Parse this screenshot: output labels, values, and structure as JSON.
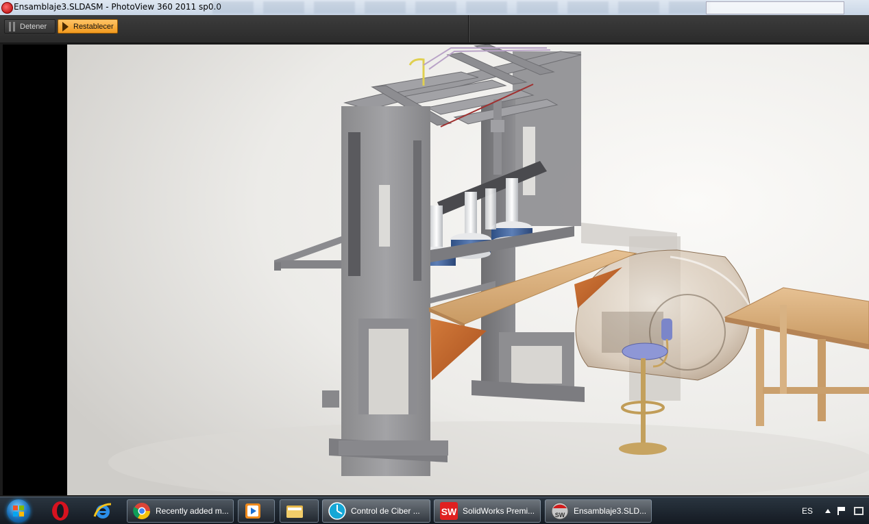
{
  "window": {
    "title": "Ensamblaje3.SLDASM - PhotoView 360 2011 sp0.0",
    "icon": "photoview-app-icon"
  },
  "toolbar": {
    "stop_label": "Detener",
    "stop_icon": "pause-icon",
    "reset_label": "Restablecer",
    "reset_icon": "play-icon",
    "reset_color": "#f7a62b"
  },
  "viewport": {
    "content": "rendered-3d-assembly",
    "background_color": "#f2f0ec",
    "left_bar_color": "#000000"
  },
  "taskbar": {
    "start_icon": "windows-start-orb",
    "pinned": [
      {
        "name": "opera-icon"
      },
      {
        "name": "internet-explorer-icon"
      }
    ],
    "tasks": [
      {
        "label": "Recently added m...",
        "icon": "chrome-icon"
      },
      {
        "label": "",
        "icon": "media-player-icon"
      },
      {
        "label": "",
        "icon": "file-explorer-icon"
      },
      {
        "label": "Control de Ciber ...",
        "icon": "cyber-control-icon"
      },
      {
        "label": "SolidWorks Premi...",
        "icon": "solidworks-icon"
      },
      {
        "label": "Ensamblaje3.SLD...",
        "icon": "photoview-icon"
      }
    ],
    "tray": {
      "language": "ES",
      "icons": [
        "show-hidden-icons",
        "action-center-flag-icon",
        "network-icon"
      ]
    }
  }
}
